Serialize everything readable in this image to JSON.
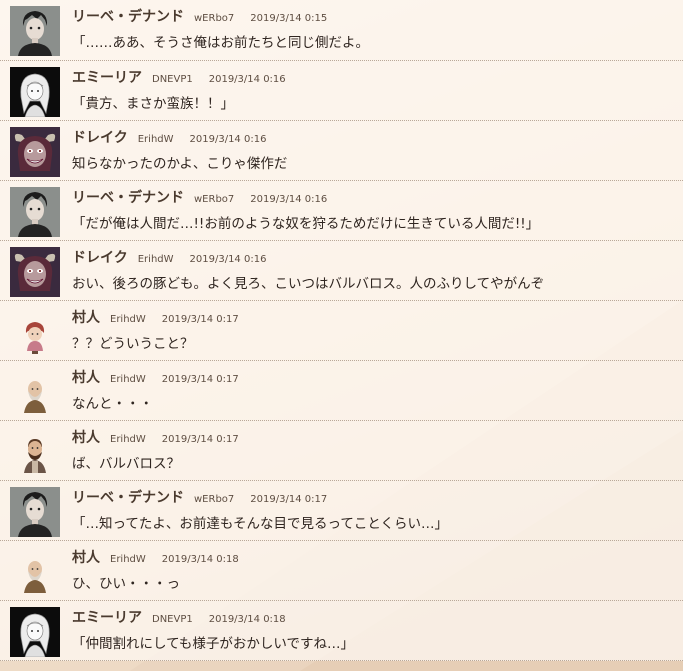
{
  "messages": [
    {
      "name": "リーベ・デナンド",
      "uid": "wERbo7",
      "time": "2019/3/14 0:15",
      "text": "「……ああ、そうさ俺はお前たちと同じ側だよ。",
      "avatar_icon": "dark-haired-man-portrait"
    },
    {
      "name": "エミーリア",
      "uid": "DNEVP1",
      "time": "2019/3/14 0:16",
      "text": "「貴方、まさか蛮族！！」",
      "avatar_icon": "white-haired-girl-sketch"
    },
    {
      "name": "ドレイク",
      "uid": "ErihdW",
      "time": "2019/3/14 0:16",
      "text": "知らなかったのかよ、こりゃ傑作だ",
      "avatar_icon": "horned-demon-portrait"
    },
    {
      "name": "リーベ・デナンド",
      "uid": "wERbo7",
      "time": "2019/3/14 0:16",
      "text": "「だが俺は人間だ…!!お前のような奴を狩るためだけに生きている人間だ!!」",
      "avatar_icon": "dark-haired-man-portrait"
    },
    {
      "name": "ドレイク",
      "uid": "ErihdW",
      "time": "2019/3/14 0:16",
      "text": "おい、後ろの豚ども。よく見ろ、こいつはバルバロス。人のふりしてやがんぞ",
      "avatar_icon": "horned-demon-portrait"
    },
    {
      "name": "村人",
      "uid": "ErihdW",
      "time": "2019/3/14 0:17",
      "text": "？？どういうこと？",
      "avatar_icon": "villager-girl-sprite"
    },
    {
      "name": "村人",
      "uid": "ErihdW",
      "time": "2019/3/14 0:17",
      "text": "なんと・・・",
      "avatar_icon": "bald-old-man-sprite"
    },
    {
      "name": "村人",
      "uid": "ErihdW",
      "time": "2019/3/14 0:17",
      "text": "ば、バルバロス？",
      "avatar_icon": "bearded-man-sprite"
    },
    {
      "name": "リーベ・デナンド",
      "uid": "wERbo7",
      "time": "2019/3/14 0:17",
      "text": "「…知ってたよ、お前達もそんな目で見るってことくらい…」",
      "avatar_icon": "dark-haired-man-portrait"
    },
    {
      "name": "村人",
      "uid": "ErihdW",
      "time": "2019/3/14 0:18",
      "text": "ひ、ひい・・・っ",
      "avatar_icon": "bald-old-man-sprite"
    },
    {
      "name": "エミーリア",
      "uid": "DNEVP1",
      "time": "2019/3/14 0:18",
      "text": "「仲間割れにしても様子がおかしいですね…」",
      "avatar_icon": "white-haired-girl-sketch"
    }
  ],
  "colors": {
    "background": "#f4e6d6",
    "row": "#fffaf4",
    "name": "#4a3a2e",
    "text": "#2f2520"
  }
}
